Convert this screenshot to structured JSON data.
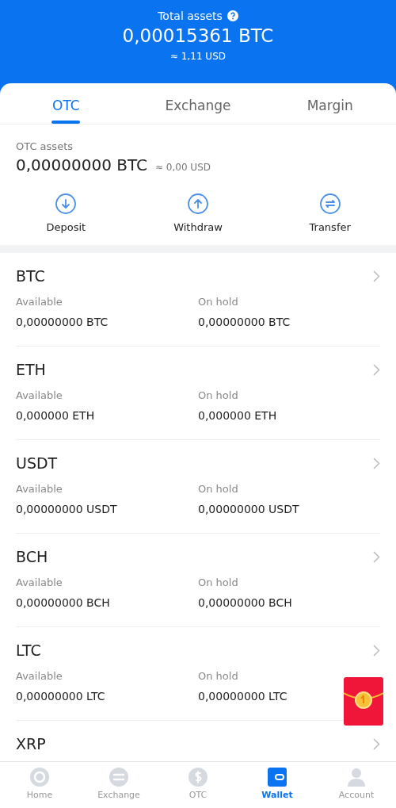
{
  "header": {
    "title": "Total assets",
    "total": "0,00015361 BTC",
    "fiat": "≈ 1,11 USD"
  },
  "tabs": [
    {
      "label": "OTC",
      "selected": true
    },
    {
      "label": "Exchange",
      "selected": false
    },
    {
      "label": "Margin",
      "selected": false
    }
  ],
  "summary": {
    "label": "OTC assets",
    "amount": "0,00000000 BTC",
    "fiat": "≈ 0,00 USD"
  },
  "actions": [
    {
      "kind": "deposit",
      "label": "Deposit"
    },
    {
      "kind": "withdraw",
      "label": "Withdraw"
    },
    {
      "kind": "transfer",
      "label": "Transfer"
    }
  ],
  "coins": [
    {
      "symbol": "BTC",
      "available_label": "Available",
      "available": "0,00000000 BTC",
      "hold_label": "On hold",
      "hold": "0,00000000 BTC"
    },
    {
      "symbol": "ETH",
      "available_label": "Available",
      "available": "0,000000 ETH",
      "hold_label": "On hold",
      "hold": "0,000000 ETH"
    },
    {
      "symbol": "USDT",
      "available_label": "Available",
      "available": "0,00000000 USDT",
      "hold_label": "On hold",
      "hold": "0,00000000 USDT"
    },
    {
      "symbol": "BCH",
      "available_label": "Available",
      "available": "0,00000000 BCH",
      "hold_label": "On hold",
      "hold": "0,00000000 BCH"
    },
    {
      "symbol": "LTC",
      "available_label": "Available",
      "available": "0,00000000 LTC",
      "hold_label": "On hold",
      "hold": "0,00000000 LTC"
    },
    {
      "symbol": "XRP"
    }
  ],
  "nav": [
    {
      "kind": "home",
      "label": "Home",
      "selected": false
    },
    {
      "kind": "exchange",
      "label": "Exchange",
      "selected": false
    },
    {
      "kind": "otc",
      "label": "OTC",
      "selected": false
    },
    {
      "kind": "wallet",
      "label": "Wallet",
      "selected": true
    },
    {
      "kind": "account",
      "label": "Account",
      "selected": false
    }
  ]
}
